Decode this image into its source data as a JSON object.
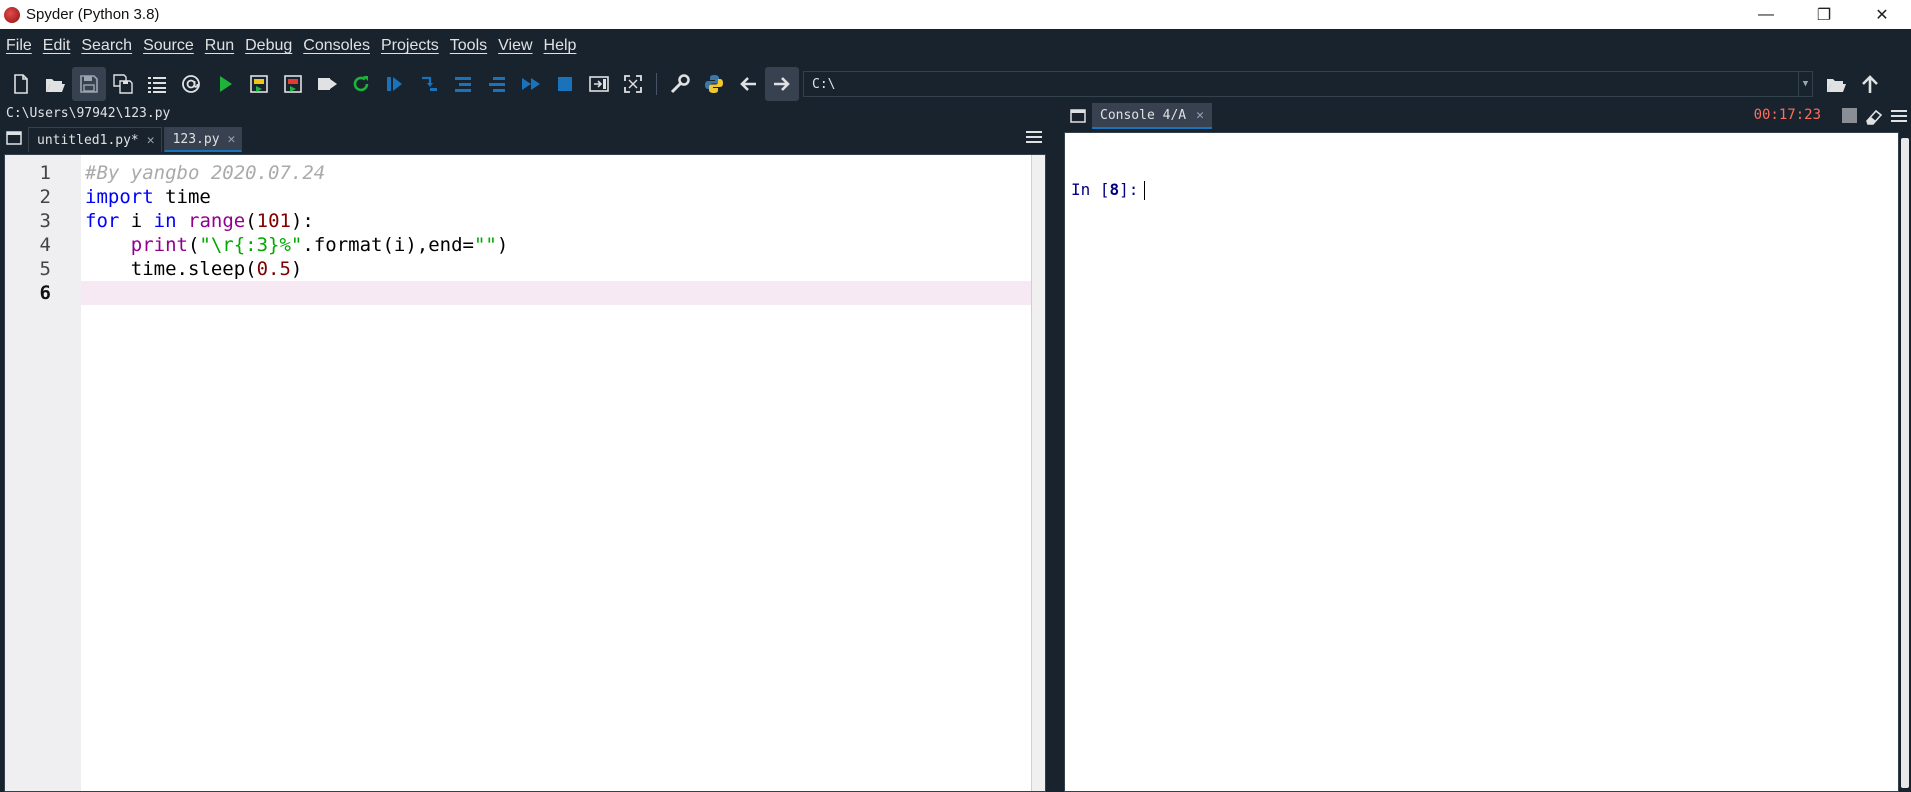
{
  "window": {
    "title": "Spyder (Python 3.8)",
    "minimize": "—",
    "maximize": "❐",
    "close": "✕"
  },
  "menu": [
    "File",
    "Edit",
    "Search",
    "Source",
    "Run",
    "Debug",
    "Consoles",
    "Projects",
    "Tools",
    "View",
    "Help"
  ],
  "toolbar": {
    "working_dir": "C:\\"
  },
  "editor": {
    "file_path": "C:\\Users\\97942\\123.py",
    "tabs": [
      {
        "label": "untitled1.py*",
        "close": "✕"
      },
      {
        "label": "123.py",
        "close": "✕"
      }
    ],
    "line_numbers": [
      "1",
      "2",
      "3",
      "4",
      "5",
      "6"
    ],
    "current_line": "6",
    "code": {
      "l1_comment": "#By yangbo 2020.07.24",
      "l2_kw": "import",
      "l2_rest": " time",
      "l3_kw1": "for",
      "l3_mid": " i ",
      "l3_kw2": "in",
      "l3_sp": " ",
      "l3_bi": "range",
      "l3_open": "(",
      "l3_num": "101",
      "l3_close": "):",
      "l4_indent": "    ",
      "l4_bi": "print",
      "l4_open": "(",
      "l4_str1": "\"\\r{:3}%\"",
      "l4_mid": ".format(i),end=",
      "l4_str2": "\"\"",
      "l4_close": ")",
      "l5_pre": "    time.sleep(",
      "l5_num": "0.5",
      "l5_close": ")"
    }
  },
  "console": {
    "tab_label": "Console 4/A",
    "tab_close": "✕",
    "timer": "00:17:23",
    "prompt_prefix": "In [",
    "prompt_number": "8",
    "prompt_suffix": "]:"
  },
  "colors": {
    "chrome_bg": "#19232d",
    "accent": "#1a72bb",
    "timer": "#ff6d5a"
  }
}
